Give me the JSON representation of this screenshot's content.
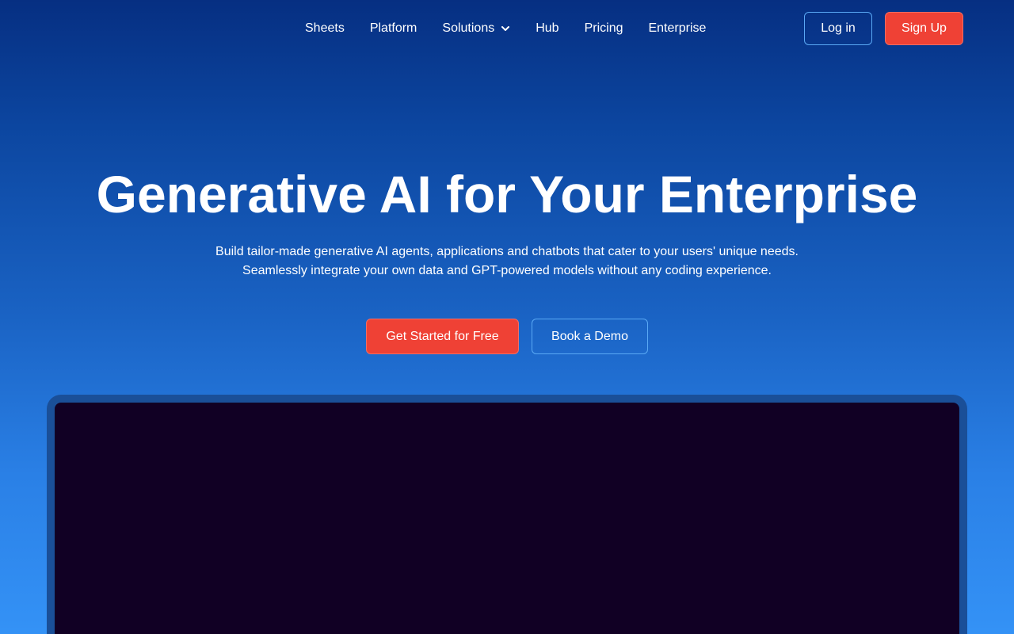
{
  "nav": {
    "items": [
      {
        "label": "Sheets"
      },
      {
        "label": "Platform"
      },
      {
        "label": "Solutions",
        "has_dropdown": true
      },
      {
        "label": "Hub"
      },
      {
        "label": "Pricing"
      },
      {
        "label": "Enterprise"
      }
    ],
    "login_label": "Log in",
    "signup_label": "Sign Up"
  },
  "hero": {
    "title": "Generative AI for Your Enterprise",
    "subtitle_line1": "Build tailor-made generative AI agents, applications and chatbots that cater to your users' unique needs.",
    "subtitle_line2": "Seamlessly integrate your own data and GPT-powered models without any coding experience.",
    "primary_cta": "Get Started for Free",
    "secondary_cta": "Book a Demo"
  },
  "colors": {
    "accent_red": "#ef4135",
    "background_top": "#062f82",
    "background_bottom": "#3492f6",
    "screen": "#110024"
  },
  "icons": {
    "dropdown": "chevron-down-icon"
  }
}
